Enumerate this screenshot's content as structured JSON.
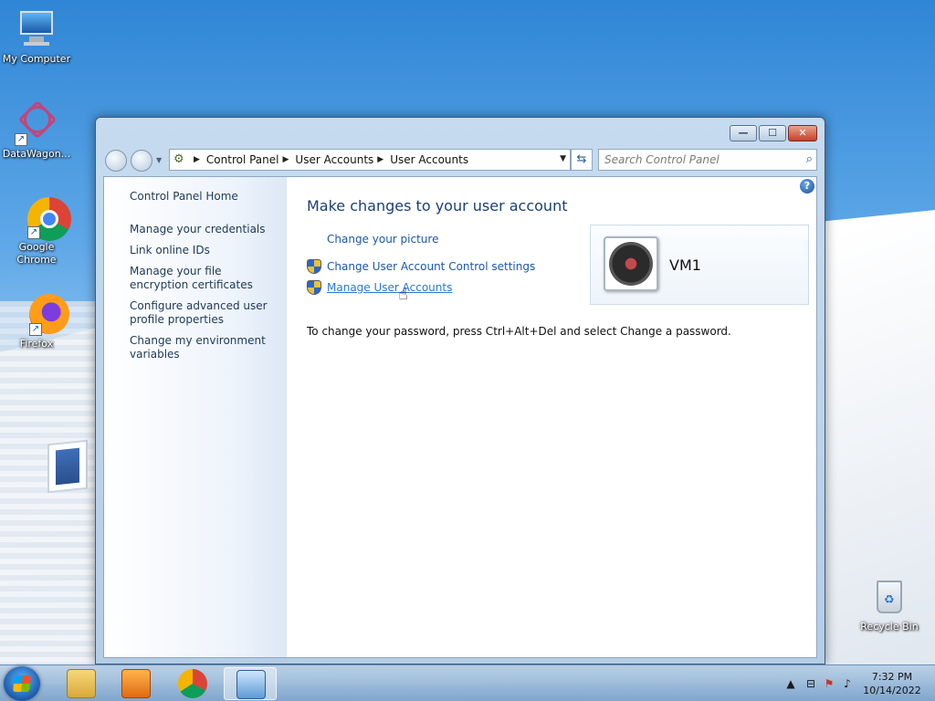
{
  "desktop": {
    "icons": [
      {
        "label": "My Computer"
      },
      {
        "label": "DataWagon..."
      },
      {
        "label": "Google Chrome"
      },
      {
        "label": "Firefox"
      },
      {
        "label": "Recycle Bin"
      }
    ]
  },
  "window": {
    "controls": {
      "minimize": "—",
      "maximize": "☐",
      "close": "✕"
    },
    "address": {
      "crumbs": [
        "Control Panel",
        "User Accounts",
        "User Accounts"
      ]
    },
    "search": {
      "placeholder": "Search Control Panel"
    },
    "sidebar": {
      "items": [
        {
          "label": "Control Panel Home"
        },
        {
          "label": "Manage your credentials"
        },
        {
          "label": "Link online IDs"
        },
        {
          "label": "Manage your file encryption certificates"
        },
        {
          "label": "Configure advanced user profile properties"
        },
        {
          "label": "Change my environment variables"
        }
      ]
    },
    "main": {
      "heading": "Make changes to your user account",
      "tasks": [
        {
          "label": "Change your picture",
          "shield": false
        },
        {
          "label": "Change User Account Control settings",
          "shield": true
        },
        {
          "label": "Manage User Accounts",
          "shield": true
        }
      ],
      "info": "To change your password, press Ctrl+Alt+Del and select Change a password.",
      "user": {
        "name": "VM1"
      }
    }
  },
  "taskbar": {
    "clock": {
      "time": "7:32 PM",
      "date": "10/14/2022"
    },
    "items": [
      "windows-explorer",
      "media-player",
      "google-chrome",
      "control-panel"
    ]
  }
}
